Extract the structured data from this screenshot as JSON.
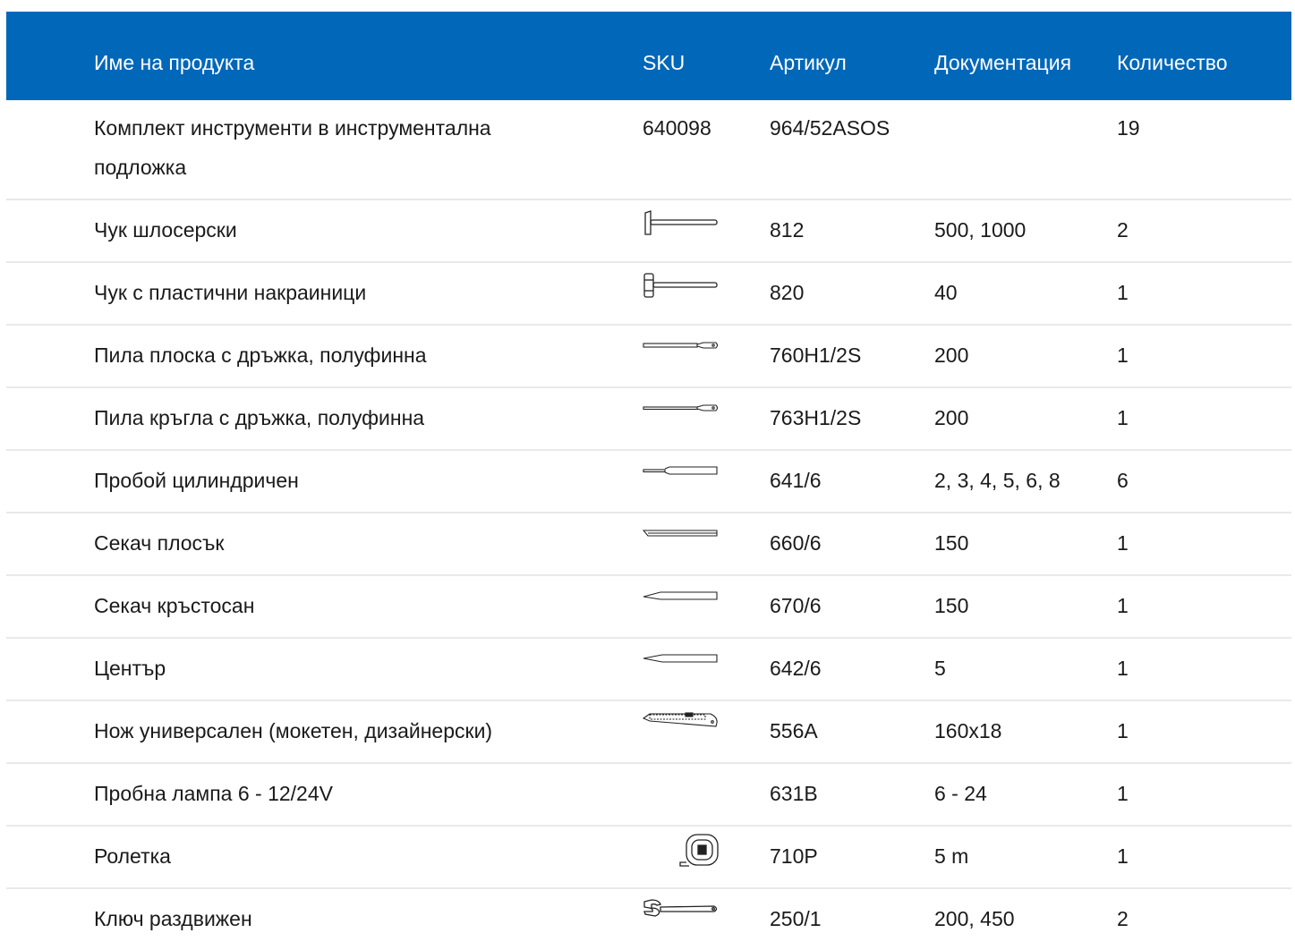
{
  "header": {
    "name": "Име на продукта",
    "sku": "SKU",
    "article": "Артикул",
    "docs": "Документация",
    "qty": "Количество"
  },
  "rows": [
    {
      "name": "Комплект инструменти в инструментална подложка",
      "sku": "640098",
      "article": "964/52ASOS",
      "docs": "",
      "qty": "19",
      "icon": ""
    },
    {
      "name": "Чук шлосерски",
      "sku": "",
      "article": "812",
      "docs": "500, 1000",
      "qty": "2",
      "icon": "machinist-hammer-icon"
    },
    {
      "name": "Чук с пластични накраиници",
      "sku": "",
      "article": "820",
      "docs": "40",
      "qty": "1",
      "icon": "soft-face-hammer-icon"
    },
    {
      "name": "Пила плоска с дръжка, полуфинна",
      "sku": "",
      "article": "760H1/2S",
      "docs": "200",
      "qty": "1",
      "icon": "flat-file-icon"
    },
    {
      "name": "Пила кръгла с дръжка, полуфинна",
      "sku": "",
      "article": "763H1/2S",
      "docs": "200",
      "qty": "1",
      "icon": "round-file-icon"
    },
    {
      "name": "Пробой цилиндричен",
      "sku": "",
      "article": "641/6",
      "docs": "2, 3, 4, 5, 6, 8",
      "qty": "6",
      "icon": "pin-punch-icon"
    },
    {
      "name": "Секач плосък",
      "sku": "",
      "article": "660/6",
      "docs": "150",
      "qty": "1",
      "icon": "flat-chisel-icon"
    },
    {
      "name": "Секач кръстосан",
      "sku": "",
      "article": "670/6",
      "docs": "150",
      "qty": "1",
      "icon": "cross-chisel-icon"
    },
    {
      "name": "Център",
      "sku": "",
      "article": "642/6",
      "docs": "5",
      "qty": "1",
      "icon": "center-punch-icon"
    },
    {
      "name": "Нож универсален (мокетен, дизайнерски)",
      "sku": "",
      "article": "556A",
      "docs": "160x18",
      "qty": "1",
      "icon": "utility-knife-icon"
    },
    {
      "name": "Пробна лампа 6 - 12/24V",
      "sku": "",
      "article": "631B",
      "docs": "6 - 24",
      "qty": "1",
      "icon": ""
    },
    {
      "name": "Ролетка",
      "sku": "",
      "article": "710P",
      "docs": "5 m",
      "qty": "1",
      "icon": "tape-measure-icon"
    },
    {
      "name": "Ключ раздвижен",
      "sku": "",
      "article": "250/1",
      "docs": "200, 450",
      "qty": "2",
      "icon": "adjustable-wrench-icon"
    }
  ]
}
